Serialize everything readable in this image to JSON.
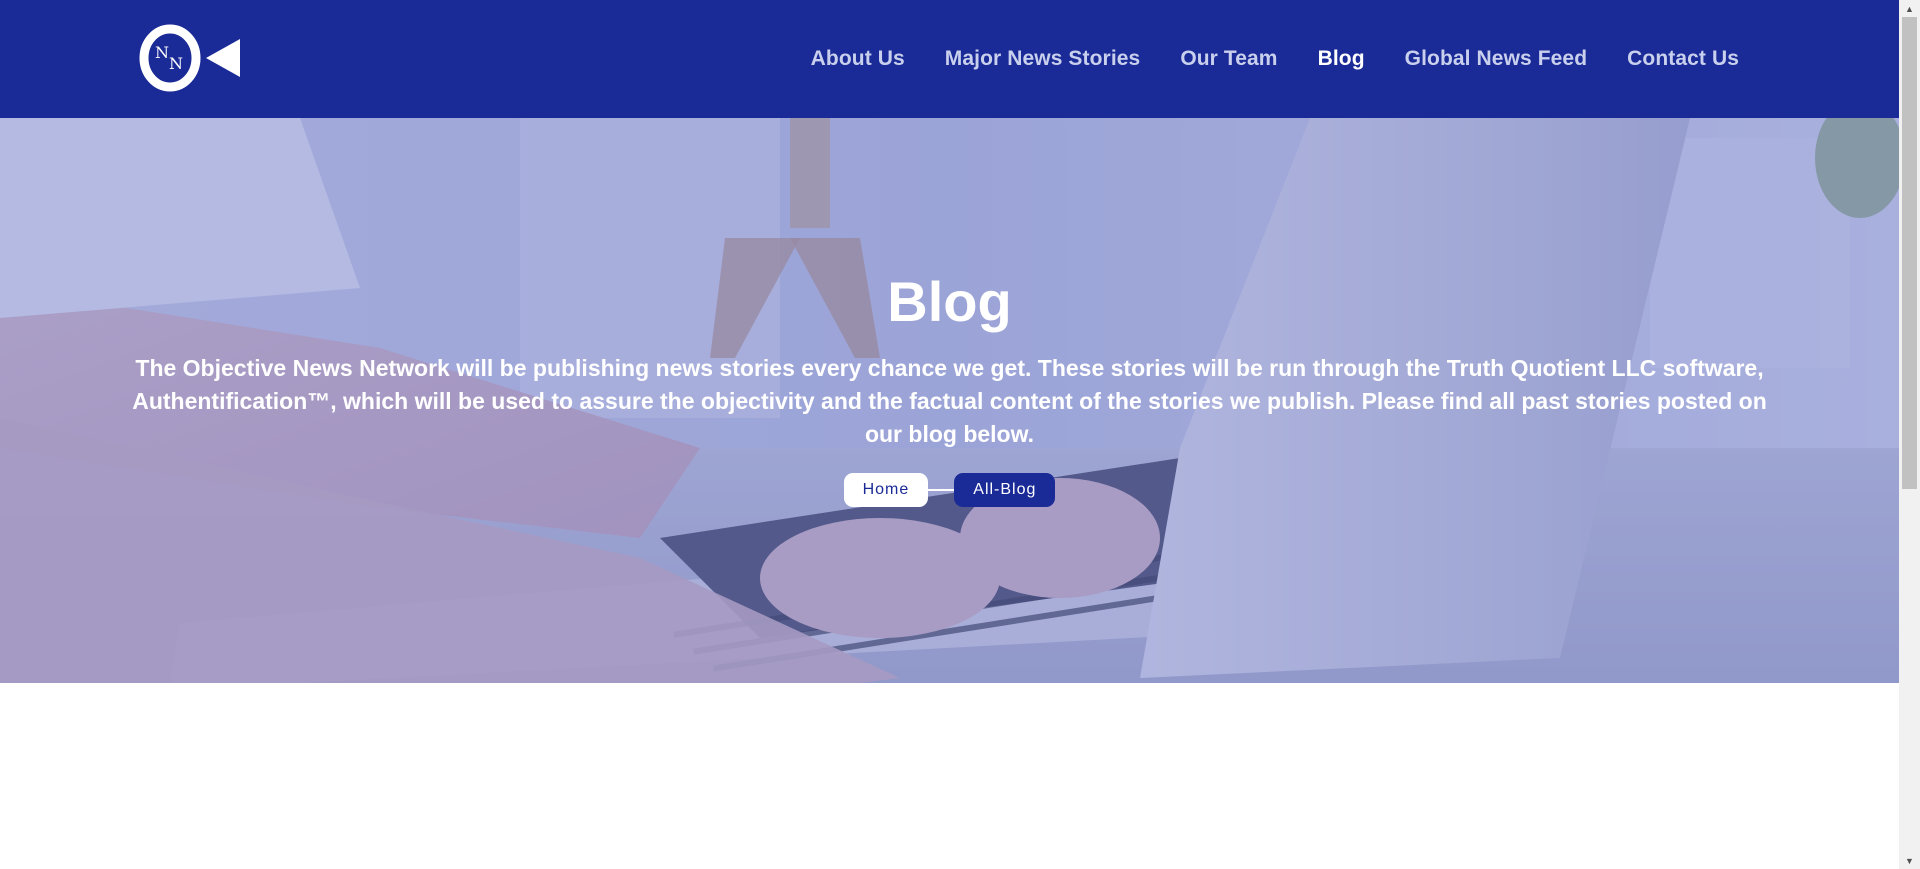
{
  "header": {
    "logo": {
      "letters": "ONN",
      "icon": "onn-logo-icon"
    },
    "nav": [
      {
        "label": "About Us",
        "active": false
      },
      {
        "label": "Major News Stories",
        "active": false
      },
      {
        "label": "Our Team",
        "active": false
      },
      {
        "label": "Blog",
        "active": true
      },
      {
        "label": "Global News Feed",
        "active": false
      },
      {
        "label": "Contact Us",
        "active": false
      }
    ]
  },
  "hero": {
    "title": "Blog",
    "description": "The Objective News Network will be publishing news stories every chance we get. These stories will be run through the Truth Quotient LLC software, Authentification™, which will be used to assure the objectivity and the factual content of the stories we publish. Please find all past stories posted on our blog below.",
    "breadcrumb": {
      "home": "Home",
      "current": "All-Blog"
    }
  },
  "colors": {
    "brand": "#1a2a96",
    "nav_text": "#c9d0ee",
    "nav_active": "#ffffff"
  }
}
